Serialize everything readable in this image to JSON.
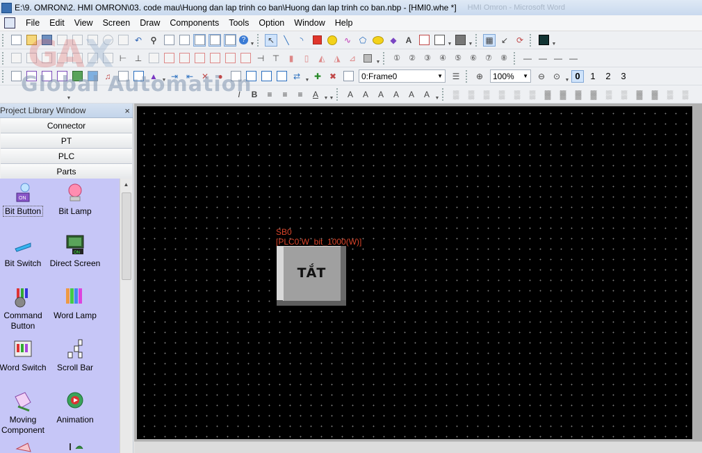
{
  "window": {
    "title": "E:\\9. OMRON\\2. HMI OMRON\\03. code mau\\Huong dan lap trinh co ban\\Huong dan lap trinh co ban.nbp - [HMI0.whe *]",
    "ghost_text": "HMI Omron - Microsoft Word"
  },
  "menu": [
    "File",
    "Edit",
    "View",
    "Screen",
    "Draw",
    "Components",
    "Tools",
    "Option",
    "Window",
    "Help"
  ],
  "watermark": {
    "text": "Global Automation"
  },
  "toolbar": {
    "frame_select": "0:Frame0",
    "zoom": "100%",
    "layers": [
      "0",
      "1",
      "2",
      "3"
    ]
  },
  "library": {
    "title": "Project Library Window",
    "close": "×",
    "categories": [
      "Connector",
      "PT",
      "PLC",
      "Parts"
    ],
    "parts": [
      {
        "label": "Bit Button",
        "icon": "bit-button-icon"
      },
      {
        "label": "Bit Lamp",
        "icon": "bit-lamp-icon"
      },
      {
        "label": "Bit Switch",
        "icon": "bit-switch-icon"
      },
      {
        "label": "Direct Screen",
        "icon": "direct-screen-icon"
      },
      {
        "label": "Command Button",
        "icon": "command-button-icon"
      },
      {
        "label": "Word Lamp",
        "icon": "word-lamp-icon"
      },
      {
        "label": "Word Switch",
        "icon": "word-switch-icon"
      },
      {
        "label": "Scroll Bar",
        "icon": "scroll-bar-icon"
      },
      {
        "label": "Moving Component",
        "icon": "moving-component-icon"
      },
      {
        "label": "Animation",
        "icon": "animation-icon"
      }
    ]
  },
  "canvas": {
    "object_name": "SB0",
    "object_address": "[PLC0:W_bit_1000(W)]",
    "button_text": "TẮT"
  }
}
